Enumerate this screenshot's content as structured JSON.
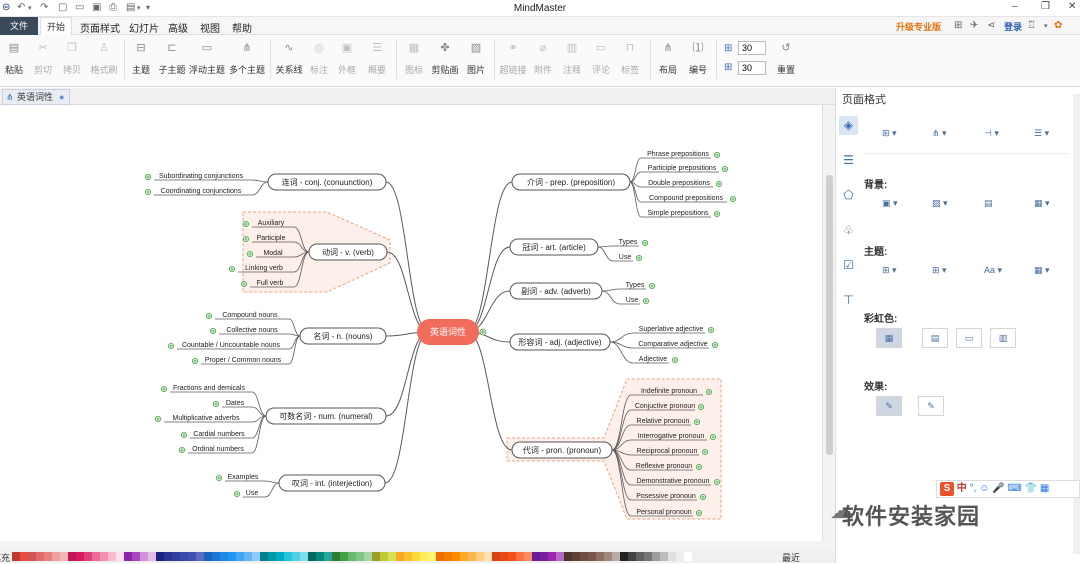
{
  "app": {
    "title": "MindMaster",
    "quick_access_icons": [
      "logo-icon",
      "undo-icon",
      "redo-icon",
      "new-icon",
      "open-icon",
      "save-icon",
      "print-icon",
      "export-icon",
      "more-icon"
    ]
  },
  "menu": {
    "file": "文件",
    "items": [
      "开始",
      "页面样式",
      "幻灯片",
      "高级",
      "视图",
      "帮助"
    ],
    "upgrade": "升级专业版",
    "login": "登录"
  },
  "ribbon": {
    "groups": [
      {
        "items": [
          {
            "label": "粘贴",
            "icon": "paste-icon",
            "enabled": true
          },
          {
            "label": "剪切",
            "icon": "cut-icon",
            "enabled": false
          },
          {
            "label": "拷贝",
            "icon": "copy-icon",
            "enabled": false
          },
          {
            "label": "格式刷",
            "icon": "format-painter-icon",
            "enabled": false
          }
        ]
      },
      {
        "items": [
          {
            "label": "主题",
            "icon": "topic-icon",
            "enabled": true
          },
          {
            "label": "子主题",
            "icon": "subtopic-icon",
            "enabled": true
          },
          {
            "label": "浮动主题",
            "icon": "floating-topic-icon",
            "enabled": true
          },
          {
            "label": "多个主题",
            "icon": "multiple-topics-icon",
            "enabled": true
          }
        ]
      },
      {
        "items": [
          {
            "label": "关系线",
            "icon": "relationship-icon",
            "enabled": true
          },
          {
            "label": "标注",
            "icon": "callout-icon",
            "enabled": false
          },
          {
            "label": "外框",
            "icon": "boundary-icon",
            "enabled": false
          },
          {
            "label": "概要",
            "icon": "summary-icon",
            "enabled": false
          }
        ]
      },
      {
        "items": [
          {
            "label": "图标",
            "icon": "icon-icon",
            "enabled": false
          },
          {
            "label": "剪贴画",
            "icon": "clipart-icon",
            "enabled": true
          },
          {
            "label": "图片",
            "icon": "picture-icon",
            "enabled": true
          }
        ]
      },
      {
        "items": [
          {
            "label": "超链接",
            "icon": "hyperlink-icon",
            "enabled": false
          },
          {
            "label": "附件",
            "icon": "attachment-icon",
            "enabled": false
          },
          {
            "label": "注释",
            "icon": "note-icon",
            "enabled": false
          },
          {
            "label": "评论",
            "icon": "comment-icon",
            "enabled": false
          },
          {
            "label": "标签",
            "icon": "tag-icon",
            "enabled": false
          }
        ]
      },
      {
        "items": [
          {
            "label": "布局",
            "icon": "layout-icon",
            "enabled": true
          },
          {
            "label": "编号",
            "icon": "numbering-icon",
            "enabled": true
          }
        ]
      }
    ],
    "spacing_h": "30",
    "spacing_v": "30",
    "reset": "重置"
  },
  "document_tab": "英语词性",
  "mindmap": {
    "center": "英语词性",
    "branches": [
      {
        "label": "连词 - conj. (conuunction)",
        "side": "left",
        "children": [
          "Subordinating conjunctions",
          "Coordinating conjunctions"
        ]
      },
      {
        "label": "动词 - v. (verb)",
        "side": "left",
        "boundary": true,
        "children": [
          "Auxiliary",
          "Participle",
          "Modal",
          "Linking verb",
          "Full  verb"
        ]
      },
      {
        "label": "名词 - n. (nouns)",
        "side": "left",
        "children": [
          "Compound nouns",
          "Collective nouns",
          "Countable / Uncountable nouns",
          "Proper / Common nouns"
        ]
      },
      {
        "label": "可数名词 - num. (numeral)",
        "side": "left",
        "children": [
          "Fractions and demicals",
          "Dates",
          "Multiplicative adverbs",
          "Cardial numbers",
          "Ordinal numbers"
        ]
      },
      {
        "label": "叹词 - int. (interjection)",
        "side": "left",
        "children": [
          "Examples",
          "Use"
        ]
      },
      {
        "label": "介词 - prep. (preposition)",
        "side": "right",
        "children": [
          "Phrase prepositions",
          "Participle prepositions",
          "Double prepositions",
          "Compound prepositions",
          "Simple prepositions"
        ]
      },
      {
        "label": "冠词 - art. (article)",
        "side": "right",
        "children": [
          "Types",
          "Use"
        ]
      },
      {
        "label": "副词 - adv. (adverb)",
        "side": "right",
        "children": [
          "Types",
          "Use"
        ]
      },
      {
        "label": "形容词 - adj. (adjective)",
        "side": "right",
        "children": [
          "Superlative adjective",
          "Comparative adjective",
          "Adjective"
        ]
      },
      {
        "label": "代词 - pron. (pronoun)",
        "side": "right",
        "boundary": true,
        "children": [
          "Indefinite pronoun",
          "Conjuctive pronoun",
          "Relative pronoun",
          "Interrogative pronoun",
          "Reciprocal pronoun",
          "Reflexive pronoun",
          "Demonstrative pronoun",
          "Posessive pronoun",
          "Personal pronoun"
        ]
      }
    ]
  },
  "palette": {
    "label": "填充",
    "recent": "最近",
    "colors": [
      "#c0392b",
      "#e74c3c",
      "#d35454",
      "#e06c6c",
      "#e88080",
      "#f0a0a0",
      "#f5b7b1",
      "#c2185b",
      "#d81b60",
      "#e0407a",
      "#ec6a98",
      "#f48fb1",
      "#f8bbd0",
      "#fde0ea",
      "#8e24aa",
      "#ab47bc",
      "#ce93d8",
      "#e1bee7",
      "#1a237e",
      "#283593",
      "#303f9f",
      "#3949ab",
      "#3f51b5",
      "#5c6bc0",
      "#1565c0",
      "#1976d2",
      "#1e88e5",
      "#2196f3",
      "#42a5f5",
      "#64b5f6",
      "#90caf9",
      "#00838f",
      "#0097a7",
      "#00acc1",
      "#26c6da",
      "#4dd0e1",
      "#80deea",
      "#00695c",
      "#00897b",
      "#26a69a",
      "#2e7d32",
      "#43a047",
      "#66bb6a",
      "#81c784",
      "#a5d6a7",
      "#9e9d24",
      "#c0ca33",
      "#d4e157",
      "#f9a825",
      "#fbc02d",
      "#fdd835",
      "#ffee58",
      "#fff176",
      "#ef6c00",
      "#f57c00",
      "#fb8c00",
      "#ffa726",
      "#ffb74d",
      "#ffcc80",
      "#ffe0b2",
      "#d84315",
      "#e64a19",
      "#f4511e",
      "#ff7043",
      "#ff8a65",
      "#6a1b9a",
      "#7b1fa2",
      "#9c27b0",
      "#ba68c8",
      "#4e342e",
      "#5d4037",
      "#6d4c41",
      "#795548",
      "#8d6e63",
      "#a1887f",
      "#bcaaa4",
      "#212121",
      "#424242",
      "#616161",
      "#757575",
      "#9e9e9e",
      "#bdbdbd",
      "#e0e0e0",
      "#eeeeee",
      "#ffffff"
    ]
  },
  "panel": {
    "title": "页面格式",
    "tabs": [
      "page-format-icon",
      "list-icon",
      "theme-icon",
      "clipart-icon",
      "task-icon",
      "outline-icon"
    ],
    "background": "背景:",
    "theme": "主题:",
    "rainbow": "彩虹色:",
    "effect": "效果:"
  },
  "watermark": "软件安装家园",
  "ime": {
    "text": "中"
  },
  "colors": {
    "center_fill": "#f26c5c",
    "center_text": "#ffffff",
    "line": "#5a5a5a",
    "node_border": "#555555",
    "expand_icon": "#3aa03a",
    "boundary_fill": "#fdf0ea",
    "boundary_stroke": "#f0a080",
    "upgrade": "#e8720c",
    "login": "#2a5db0"
  }
}
